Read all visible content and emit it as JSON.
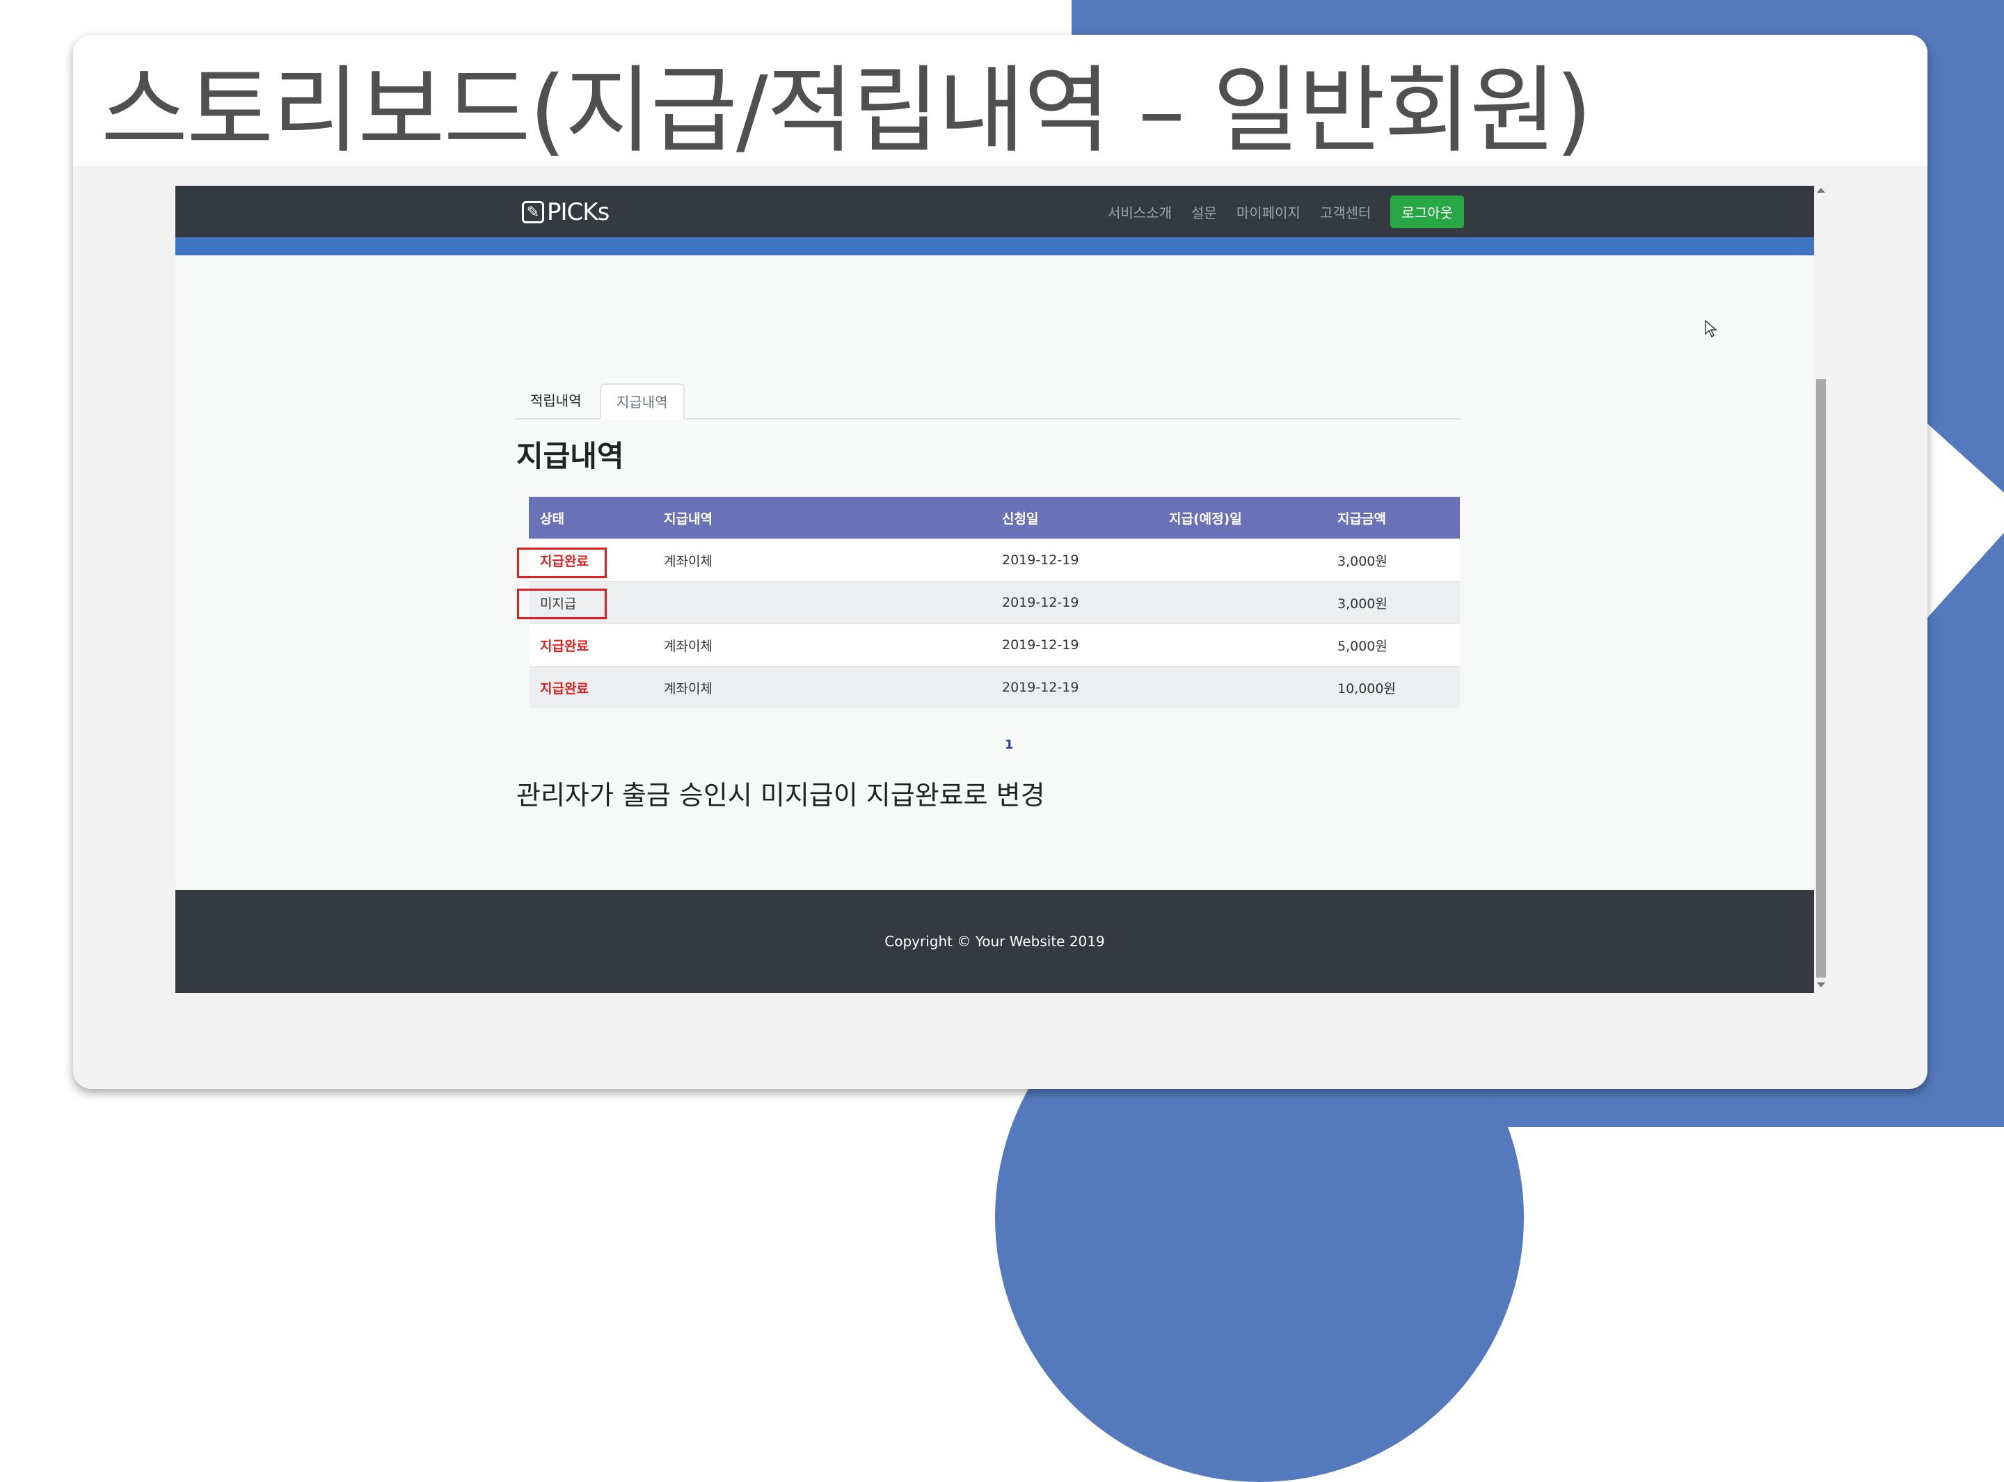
{
  "slide": {
    "title": "스토리보드(지급/적립내역 – 일반회원)"
  },
  "navbar": {
    "logo_text": "PICKs",
    "logo_icon": "pencil-icon",
    "links": [
      "서비스소개",
      "설문",
      "마이페이지",
      "고객센터"
    ],
    "logout_label": "로그아웃"
  },
  "tabs": [
    "적립내역",
    "지급내역"
  ],
  "section_title": "지급내역",
  "table": {
    "headers": [
      "상태",
      "지급내역",
      "신청일",
      "지급(예정)일",
      "지급금액"
    ],
    "rows": [
      {
        "status": "지급완료",
        "method": "계좌이체",
        "applied": "2019-12-19",
        "scheduled": "",
        "amount": "3,000원"
      },
      {
        "status": "미지급",
        "method": "",
        "applied": "2019-12-19",
        "scheduled": "",
        "amount": "3,000원"
      },
      {
        "status": "지급완료",
        "method": "계좌이체",
        "applied": "2019-12-19",
        "scheduled": "",
        "amount": "5,000원"
      },
      {
        "status": "지급완료",
        "method": "계좌이체",
        "applied": "2019-12-19",
        "scheduled": "",
        "amount": "10,000원"
      }
    ]
  },
  "pagination": {
    "current": "1"
  },
  "caption": "관리자가 출금 승인시 미지급이 지급완료로 변경",
  "footer": {
    "copyright": "Copyright © Your Website 2019"
  },
  "colors": {
    "navbar": "#343a40",
    "accent": "#3f73c4",
    "table_header": "#6a72b7",
    "logout": "#28a745",
    "status_done": "#e02020",
    "highlight": "#e02020",
    "slide_bg": "#5479bd"
  }
}
